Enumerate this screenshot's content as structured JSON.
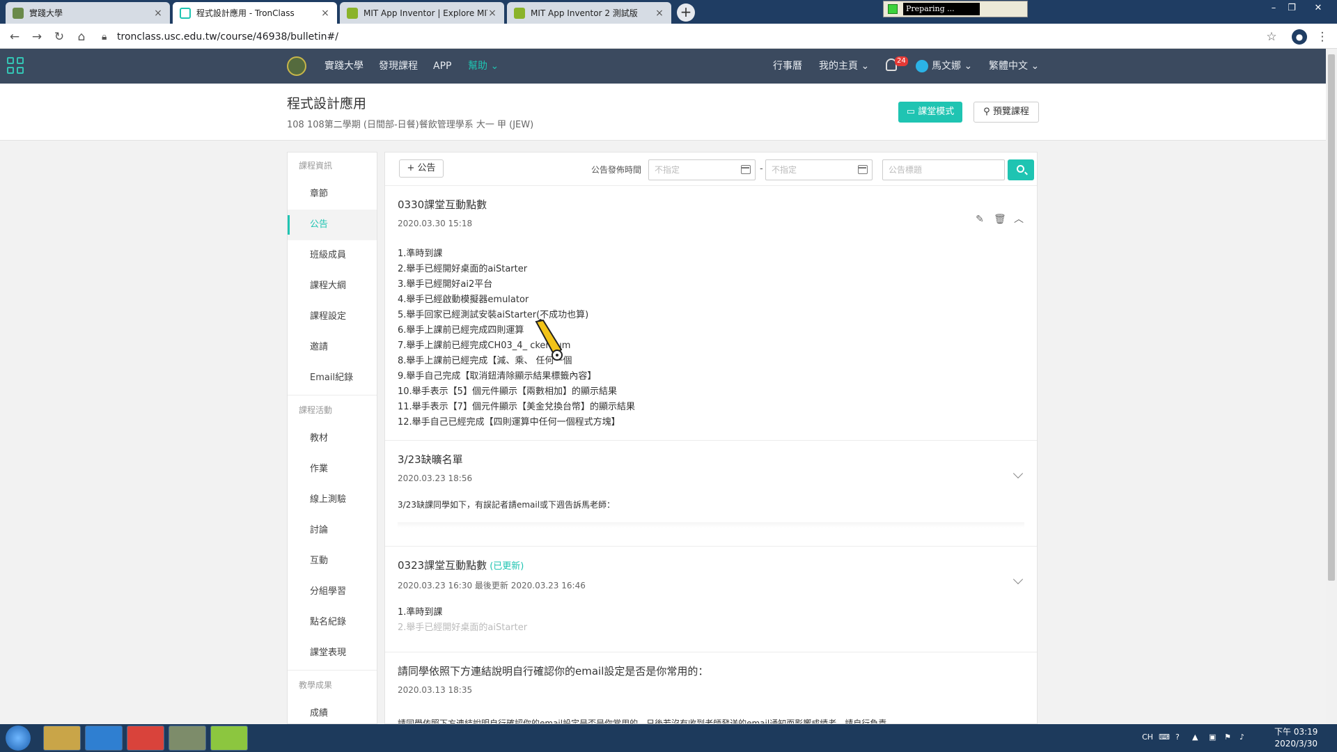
{
  "browser": {
    "tabs": [
      {
        "label": "實踐大學",
        "active": false
      },
      {
        "label": "程式設計應用 - TronClass",
        "active": true
      },
      {
        "label": "MIT App Inventor | Explore MIT",
        "active": false
      },
      {
        "label": "MIT App Inventor 2 測試版",
        "active": false
      }
    ],
    "new_tab": "+",
    "url": "tronclass.usc.edu.tw/course/46938/bulletin#/",
    "recorder_label": "Preparing ..."
  },
  "topnav": {
    "links": [
      "實踐大學",
      "發現課程",
      "APP",
      "幫助"
    ],
    "help_label": "幫助",
    "calendar": "行事曆",
    "my_home": "我的主頁",
    "notif_count": "24",
    "user": "馬文娜",
    "language": "繁體中文"
  },
  "course": {
    "title": "程式設計應用",
    "subtitle": "108 108第二學期 (日間部-日餐)餐飲管理學系 大一 甲 (JEW)",
    "classroom_mode": "課堂模式",
    "preview_course": "預覽課程"
  },
  "sidebar": {
    "sections": [
      {
        "title": "課程資訊",
        "items": [
          "章節",
          "公告",
          "班級成員",
          "課程大綱",
          "課程設定",
          "邀請",
          "Email紀錄"
        ]
      },
      {
        "title": "課程活動",
        "items": [
          "教材",
          "作業",
          "線上測驗",
          "討論",
          "互動",
          "分組學習",
          "點名紀錄",
          "課堂表現"
        ]
      },
      {
        "title": "教學成果",
        "items": [
          "成績"
        ]
      }
    ],
    "active": "公告"
  },
  "toolbar": {
    "add_label": "+ 公告",
    "filter_label": "公告發佈時間",
    "start_placeholder": "不指定",
    "end_placeholder": "不指定",
    "separator": "-",
    "title_placeholder": "公告標題"
  },
  "posts": [
    {
      "title": "0330課堂互動點數",
      "date": "2020.03.30 15:18",
      "lines": [
        "1.準時到課",
        "2.舉手已經開好桌面的aiStarter",
        "3.舉手已經開好ai2平台",
        "4.舉手已經啟動模擬器emulator",
        "5.舉手回家已經測試安裝aiStarter(不成功也算)",
        "6.舉手上課前已經完成四則運算",
        "7.舉手上課前已經完成CH03_4_ ckerNum",
        "8.舉手上課前已經完成【減、乘、 任何一個",
        "9.舉手自己完成【取消鈕清除顯示結果標籤內容】",
        "10.舉手表示【5】個元件顯示【兩數相加】的顯示結果",
        "11.舉手表示【7】個元件顯示【美金兌換台幣】的顯示結果",
        "12.舉手自己已經完成【四則運算中任何一個程式方塊】"
      ]
    },
    {
      "title": "3/23缺曠名單",
      "date": "2020.03.23 18:56",
      "lines": [
        "3/23缺課同學如下，有誤記者請email或下週告訴馬老師："
      ]
    },
    {
      "title": "0323課堂互動點數",
      "updated_tag": "(已更新)",
      "date": "2020.03.23 16:30 最後更新 2020.03.23 16:46",
      "lines": [
        "1.準時到課",
        "2.舉手已經開好桌面的aiStarter"
      ]
    },
    {
      "title": "請同學依照下方連結說明自行確認你的email設定是否是你常用的：",
      "date": "2020.03.13 18:35",
      "lines": [
        "請同學依照下方連結說明自行確認你的email設定是否是你常用的，日後若沒有收到老師發送的email通知而影響成績者，請自行負責。"
      ]
    }
  ],
  "taskbar": {
    "lang": "CH",
    "time": "下午 03:19",
    "date": "2020/3/30"
  },
  "colors": {
    "accent": "#1fc4b2",
    "appbar": "#3b4a5f",
    "badge": "#e53935"
  }
}
